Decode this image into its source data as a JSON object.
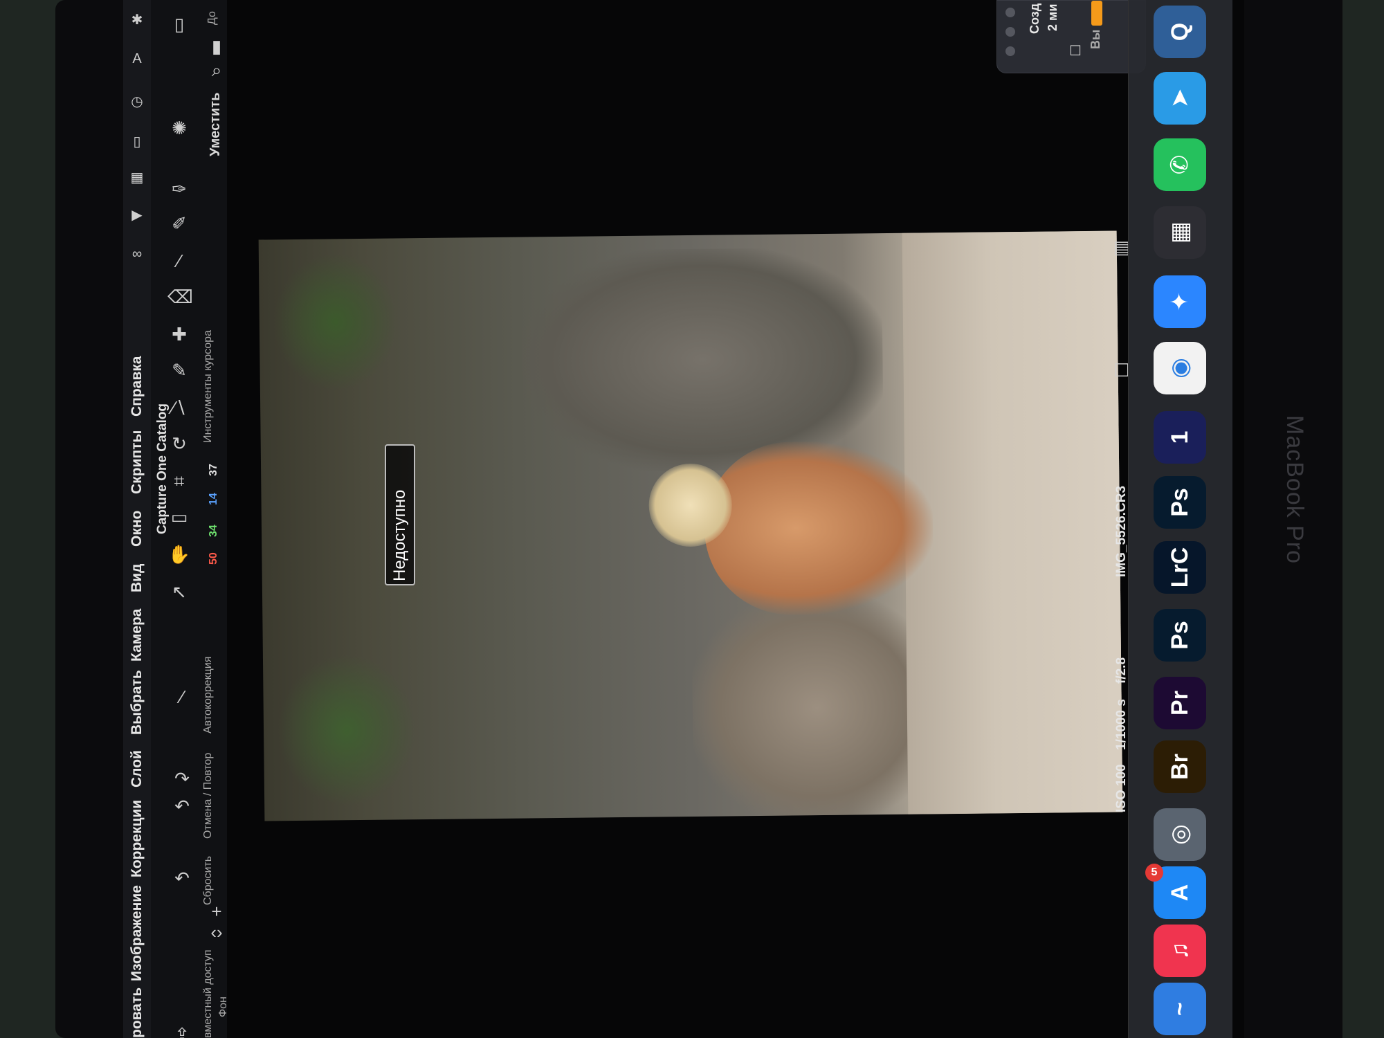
{
  "device": {
    "brand_label": "MacBook Pro"
  },
  "menubar": {
    "items": [
      "ровать",
      "Изображение",
      "Коррекции",
      "Слой",
      "Выбрать",
      "Камера",
      "Вид",
      "Окно",
      "Скрипты",
      "Справка"
    ]
  },
  "toolbar": {
    "labels": {
      "shared": "вместный доступ",
      "reset": "Сбросить",
      "undo_redo": "Отмена / Повтор",
      "auto": "Автокоррекция",
      "cursor_tools": "Инструменты курсора",
      "fit": "Уместить",
      "layer": "Фон"
    },
    "title": "Capture One Catalog",
    "histogram": {
      "r": "50",
      "g": "34",
      "b": "14",
      "l": "37"
    }
  },
  "viewer": {
    "unavailable_label": "Недоступно",
    "filename": "IMG_5526.CR3",
    "iso": "ISO 100",
    "shutter": "1/1000 s",
    "aperture": "f/2.8"
  },
  "notification": {
    "line1": "Созд",
    "line2": "2 ми",
    "line3": "Вы мож",
    "corner": "До"
  },
  "dock": {
    "apps": [
      {
        "name": "Freeform",
        "label": "~",
        "color": "#2f7de1"
      },
      {
        "name": "Music",
        "label": "♫",
        "color": "#f0344f"
      },
      {
        "name": "App Store",
        "label": "A",
        "color": "#1e88f5",
        "badge": "5"
      },
      {
        "name": "Capture One",
        "label": "◎",
        "color": "#5a6470"
      },
      {
        "name": "Bridge",
        "label": "Br",
        "color": "#2c1d05"
      },
      {
        "name": "Premiere",
        "label": "Pr",
        "color": "#1d0a33"
      },
      {
        "name": "Photoshop",
        "label": "Ps",
        "color": "#061b2e"
      },
      {
        "name": "Lightroom Classic",
        "label": "LrC",
        "color": "#06162a"
      },
      {
        "name": "Photoshop 2",
        "label": "Ps",
        "color": "#061b2e"
      },
      {
        "name": "One",
        "label": "1",
        "color": "#1a1f5a"
      },
      {
        "name": "Chrome",
        "label": "◉",
        "color": "#f2f2f2"
      },
      {
        "name": "Safari",
        "label": "✦",
        "color": "#2b86ff"
      },
      {
        "name": "Photo Booth",
        "label": "▦",
        "color": "#2d2d33"
      },
      {
        "name": "WhatsApp",
        "label": "✆",
        "color": "#25c15d"
      },
      {
        "name": "Telegram",
        "label": "➤",
        "color": "#2a9be6"
      },
      {
        "name": "QuickTime",
        "label": "Q",
        "color": "#2f5f98"
      }
    ]
  }
}
